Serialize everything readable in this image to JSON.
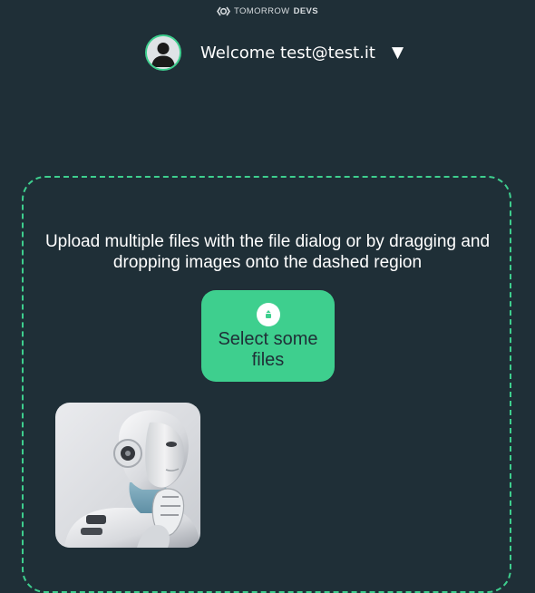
{
  "brand": {
    "light": "TOMORROW",
    "bold": "DEVS",
    "logo_icon": "brand-logo-icon"
  },
  "header": {
    "welcome_text": "Welcome test@test.it",
    "dropdown_symbol": "▼",
    "avatar_icon": "user-avatar-icon"
  },
  "dropzone": {
    "instructions": "Upload multiple files with the file dialog or by dragging and dropping images onto the dashed region",
    "select_button_label": "Select some files",
    "upload_icon": "upload-icon"
  },
  "uploads": [
    {
      "kind": "image",
      "subject": "robot-thumbnail"
    }
  ],
  "colors": {
    "background": "#1f2f37",
    "accent": "#3ecf8e",
    "text": "#ffffff",
    "button_text": "#1f2f37"
  }
}
